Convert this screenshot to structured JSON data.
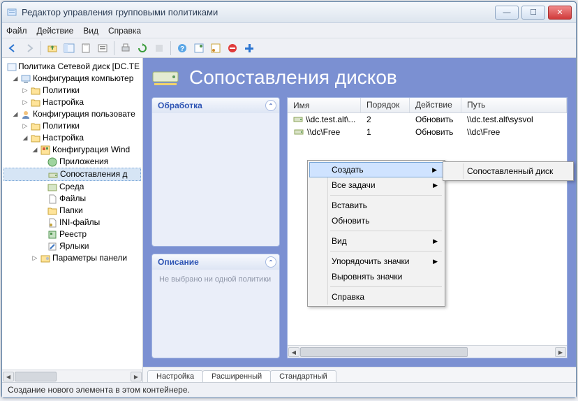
{
  "window": {
    "title": "Редактор управления групповыми политиками"
  },
  "menubar": [
    "Файл",
    "Действие",
    "Вид",
    "Справка"
  ],
  "tree": {
    "root": "Политика Сетевой диск [DC.TE",
    "comp_config": "Конфигурация компьютер",
    "comp_policies": "Политики",
    "comp_settings": "Настройка",
    "user_config": "Конфигурация пользовате",
    "user_policies": "Политики",
    "user_settings": "Настройка",
    "win_config": "Конфигурация Wind",
    "apps": "Приложения",
    "drive_map": "Сопоставления д",
    "env": "Среда",
    "files": "Файлы",
    "folders": "Папки",
    "ini": "INI-файлы",
    "registry": "Реестр",
    "shortcuts": "Ярлыки",
    "ctrl_params": "Параметры панели"
  },
  "page": {
    "title": "Сопоставления дисков",
    "panel_processing": "Обработка",
    "panel_description": "Описание",
    "desc_text": "Не выбрано ни одной политики"
  },
  "list": {
    "headers": {
      "name": "Имя",
      "order": "Порядок",
      "action": "Действие",
      "path": "Путь"
    },
    "rows": [
      {
        "name": "\\\\dc.test.alt\\...",
        "order": "2",
        "action": "Обновить",
        "path": "\\\\dc.test.alt\\sysvol"
      },
      {
        "name": "\\\\dc\\Free",
        "order": "1",
        "action": "Обновить",
        "path": "\\\\dc\\Free"
      }
    ]
  },
  "context_menu": {
    "create": "Создать",
    "all_tasks": "Все задачи",
    "paste": "Вставить",
    "refresh": "Обновить",
    "view": "Вид",
    "arrange": "Упорядочить значки",
    "align": "Выровнять значки",
    "help": "Справка",
    "submenu_item": "Сопоставленный диск"
  },
  "tabs": [
    "Настройка",
    "Расширенный",
    "Стандартный"
  ],
  "status": "Создание нового элемента в этом контейнере."
}
